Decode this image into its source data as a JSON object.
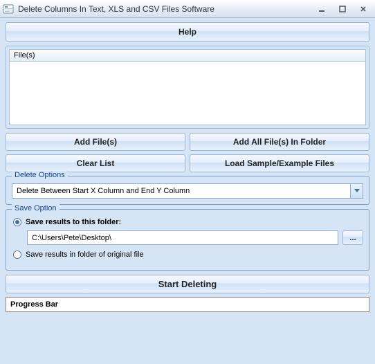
{
  "window": {
    "title": "Delete Columns In Text, XLS and CSV Files Software"
  },
  "help_label": "Help",
  "files_header": "File(s)",
  "buttons": {
    "add_files": "Add File(s)",
    "add_all_folder": "Add All File(s) In Folder",
    "clear_list": "Clear List",
    "load_sample": "Load Sample/Example Files",
    "browse": "..."
  },
  "delete_options": {
    "legend": "Delete Options",
    "selected": "Delete Between Start X Column and End Y Column"
  },
  "save_option": {
    "legend": "Save Option",
    "radio_folder": "Save results to this folder:",
    "radio_original": "Save results in folder of original file",
    "path": "C:\\Users\\Pete\\Desktop\\"
  },
  "start_label": "Start Deleting",
  "progress_label": "Progress Bar"
}
